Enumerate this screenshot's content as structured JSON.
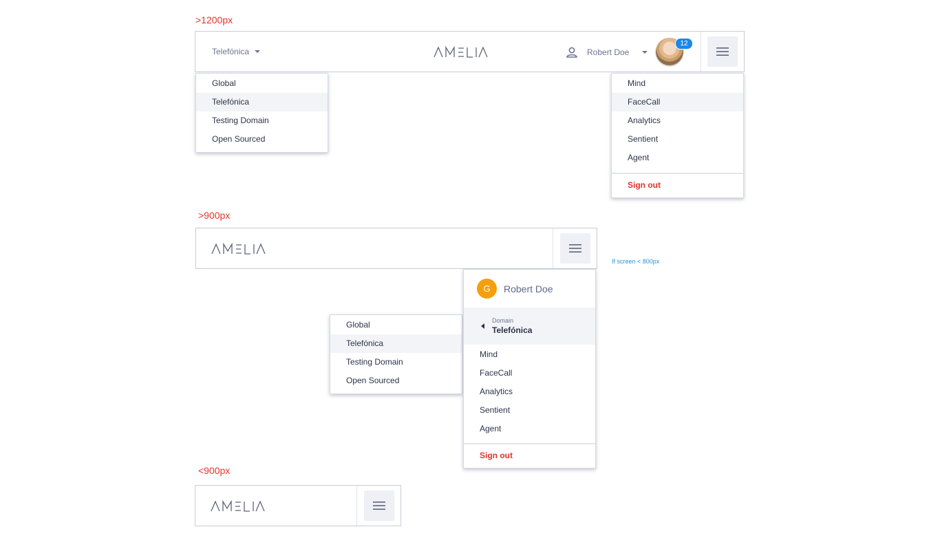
{
  "breakpoints": {
    "large": ">1200px",
    "medium": ">900px",
    "small": "<900px"
  },
  "note": "If screen < 800px",
  "header": {
    "logo_text": "AMELIA",
    "domain_selected": "Telefónica",
    "user_name": "Robert Doe",
    "notification_count": "12"
  },
  "domains": [
    "Global",
    "Telefónica",
    "Testing Domain",
    "Open Sourced"
  ],
  "apps": [
    "Mind",
    "FaceCall",
    "Analytics",
    "Sentient",
    "Agent"
  ],
  "signout_label": "Sign out",
  "mobile_menu": {
    "avatar_letter": "G",
    "user_name": "Robert Doe",
    "domain_caption": "Domain",
    "domain_value": "Telefónica"
  },
  "colors": {
    "accent_red": "#e0322b",
    "badge_blue": "#1e88e5",
    "avatar_orange": "#f59f0b"
  }
}
